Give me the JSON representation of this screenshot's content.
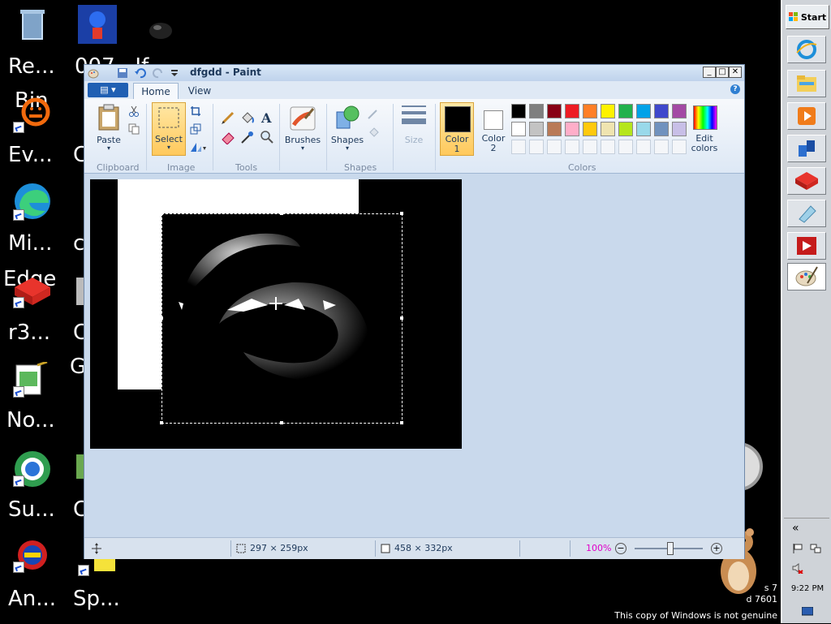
{
  "desktop": {
    "icons": [
      {
        "label": "Re...",
        "icon": "recycle-bin-icon"
      },
      {
        "label": "Ev...",
        "icon": "eventghost-icon"
      },
      {
        "label": "Mi...",
        "icon": "edge-icon"
      },
      {
        "label": "r3...",
        "icon": "r3-icon"
      },
      {
        "label": "No...",
        "icon": "notepad-icon"
      },
      {
        "label": "Su...",
        "icon": "browser-icon"
      },
      {
        "label": "An...",
        "icon": "star-wars-icon"
      },
      {
        "label": "Sp...",
        "icon": "spongebob-icon"
      }
    ],
    "partial_labels": {
      "col2_row1": "007...If",
      "col2_row2": "C",
      "col2_row3": "c",
      "col2_row4": "C",
      "col2_row5": "G",
      "col2_row6": "C",
      "bin_overlap": "Bin",
      "edge_overlap": "Edge"
    }
  },
  "taskbar": {
    "start_label": "Start",
    "apps": [
      {
        "name": "internet-explorer",
        "icon": "ie-icon"
      },
      {
        "name": "file-explorer",
        "icon": "folder-icon"
      },
      {
        "name": "media-player",
        "icon": "media-player-icon"
      },
      {
        "name": "network",
        "icon": "network-icon"
      },
      {
        "name": "r3-app",
        "icon": "r3-icon"
      },
      {
        "name": "notepad-app",
        "icon": "notepad-icon"
      },
      {
        "name": "flash-app",
        "icon": "flash-icon"
      },
      {
        "name": "paint-app",
        "icon": "paint-icon"
      }
    ],
    "tray_arrow": "«",
    "clock": "9:22 PM"
  },
  "os": {
    "edition_line1": "s 7",
    "edition_line2": "d 7601",
    "genuine_notice": "This copy of Windows is not genuine"
  },
  "paint": {
    "title": "dfgdd - Paint",
    "tabs": {
      "home": "Home",
      "view": "View"
    },
    "help": "?",
    "ribbon": {
      "clipboard": {
        "paste": "Paste",
        "label": "Clipboard"
      },
      "image": {
        "select": "Select",
        "label": "Image"
      },
      "tools": {
        "label": "Tools"
      },
      "brushes": {
        "label": "Brushes"
      },
      "shapes": {
        "shapes": "Shapes",
        "label": "Shapes"
      },
      "size": {
        "label": "Size"
      },
      "colors": {
        "color1": "Color\n1",
        "color1_a": "Color",
        "color1_b": "1",
        "color2_a": "Color",
        "color2_b": "2",
        "edit_a": "Edit",
        "edit_b": "colors",
        "label": "Colors",
        "color1_value": "#000000",
        "color2_value": "#ffffff",
        "palette_row1": [
          "#000000",
          "#7f7f7f",
          "#880015",
          "#ed1c24",
          "#ff7f27",
          "#fff200",
          "#22b14c",
          "#00a2e8",
          "#3f48cc",
          "#a349a4"
        ],
        "palette_row2": [
          "#ffffff",
          "#c3c3c3",
          "#b97a57",
          "#ffaec9",
          "#ffc90e",
          "#efe4b0",
          "#b5e61d",
          "#99d9ea",
          "#7092be",
          "#c8bfe7"
        ]
      }
    },
    "status": {
      "selection_size": "297 × 259px",
      "canvas_size": "458 × 332px",
      "zoom": "100%"
    }
  }
}
